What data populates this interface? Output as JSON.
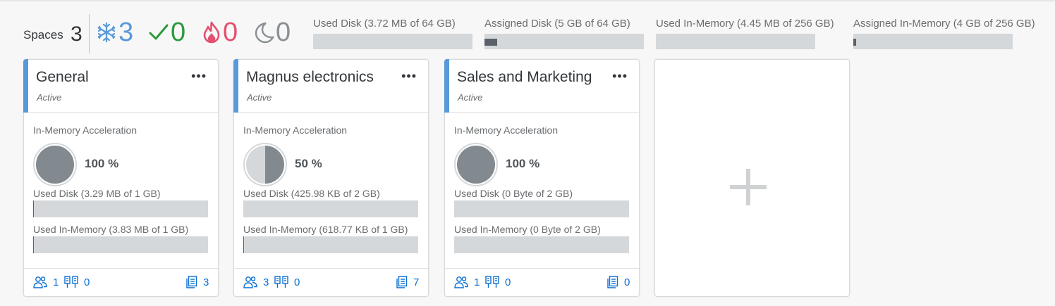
{
  "summary": {
    "spaces_label": "Spaces",
    "spaces_count": "3",
    "stats": [
      {
        "name": "snowflake-icon",
        "value": "3",
        "color": "#5899da"
      },
      {
        "name": "checkmark-icon",
        "value": "0",
        "color": "#2b9a3e"
      },
      {
        "name": "flame-icon",
        "value": "0",
        "color": "#e4506f"
      },
      {
        "name": "moon-icon",
        "value": "0",
        "color": "#8a8f93"
      }
    ],
    "meters": [
      {
        "label": "Used Disk (3.72 MB of 64 GB)",
        "fraction": 0.0001
      },
      {
        "label": "Assigned Disk (5 GB of 64 GB)",
        "fraction": 0.078
      },
      {
        "label": "Used In-Memory (4.45 MB of 256 GB)",
        "fraction": 0.0001
      },
      {
        "label": "Assigned In-Memory (4 GB of 256 GB)",
        "fraction": 0.016
      }
    ]
  },
  "cards": [
    {
      "title": "General",
      "status": "Active",
      "more_label": "•••",
      "accel_label": "In-Memory Acceleration",
      "accel_fraction": 1.0,
      "accel_pct": "100 %",
      "used_disk_label": "Used Disk (3.29 MB of 1 GB)",
      "used_disk_fraction": 0.003,
      "used_mem_label": "Used In-Memory (3.83 MB of 1 GB)",
      "used_mem_fraction": 0.004,
      "members": "1",
      "connections": "0",
      "objects": "3"
    },
    {
      "title": "Magnus electronics",
      "status": "Active",
      "more_label": "•••",
      "accel_label": "In-Memory Acceleration",
      "accel_fraction": 0.5,
      "accel_pct": "50 %",
      "used_disk_label": "Used Disk (425.98 KB of 2 GB)",
      "used_disk_fraction": 0.0002,
      "used_mem_label": "Used In-Memory (618.77 KB of 1 GB)",
      "used_mem_fraction": 0.0006,
      "members": "3",
      "connections": "0",
      "objects": "7"
    },
    {
      "title": "Sales and Marketing",
      "status": "Active",
      "more_label": "•••",
      "accel_label": "In-Memory Acceleration",
      "accel_fraction": 1.0,
      "accel_pct": "100 %",
      "used_disk_label": "Used Disk (0 Byte of 2 GB)",
      "used_disk_fraction": 0,
      "used_mem_label": "Used In-Memory (0 Byte of 2 GB)",
      "used_mem_fraction": 0,
      "members": "1",
      "connections": "0",
      "objects": "0"
    }
  ],
  "colors": {
    "accent": "#5899da",
    "link": "#0a6ed1",
    "bar_track": "#d5d8db",
    "bar_fill": "#5b6168",
    "gauge_fill": "#828a8f"
  }
}
